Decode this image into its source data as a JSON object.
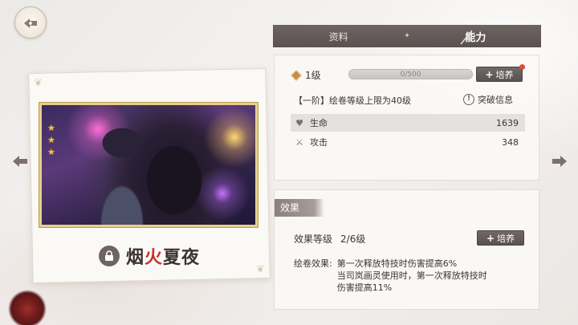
{
  "nav": {
    "back_icon": "back-emblem-icon"
  },
  "card": {
    "title_part1": "烟",
    "title_highlight": "火",
    "title_part2": "夏夜",
    "stars": 3,
    "locked": true
  },
  "tabs": [
    {
      "label": "资料",
      "active": false
    },
    {
      "label": "能力",
      "active": true
    }
  ],
  "stats": {
    "level_label": "1级",
    "progress_text": "0/500",
    "progress_fraction": 0.0,
    "train_label": "培养",
    "rank_text": "【一阶】绘卷等级上限为40级",
    "breakthrough_label": "突破信息",
    "rows": [
      {
        "name": "生命",
        "value": "1639"
      },
      {
        "name": "攻击",
        "value": "348"
      }
    ]
  },
  "effect": {
    "tag": "效果",
    "level_label": "效果等级",
    "level_value": "2/6级",
    "train_label": "培养",
    "desc_label": "绘卷效果:",
    "desc_lines": [
      "第一次释放特技时伤害提高6%",
      "当司岚画灵使用时，第一次释放特技时",
      "伤害提高11%"
    ]
  },
  "colors": {
    "accent_red": "#c0322b",
    "dark_button": "#5a5251",
    "notify_dot": "#e04a3d"
  }
}
